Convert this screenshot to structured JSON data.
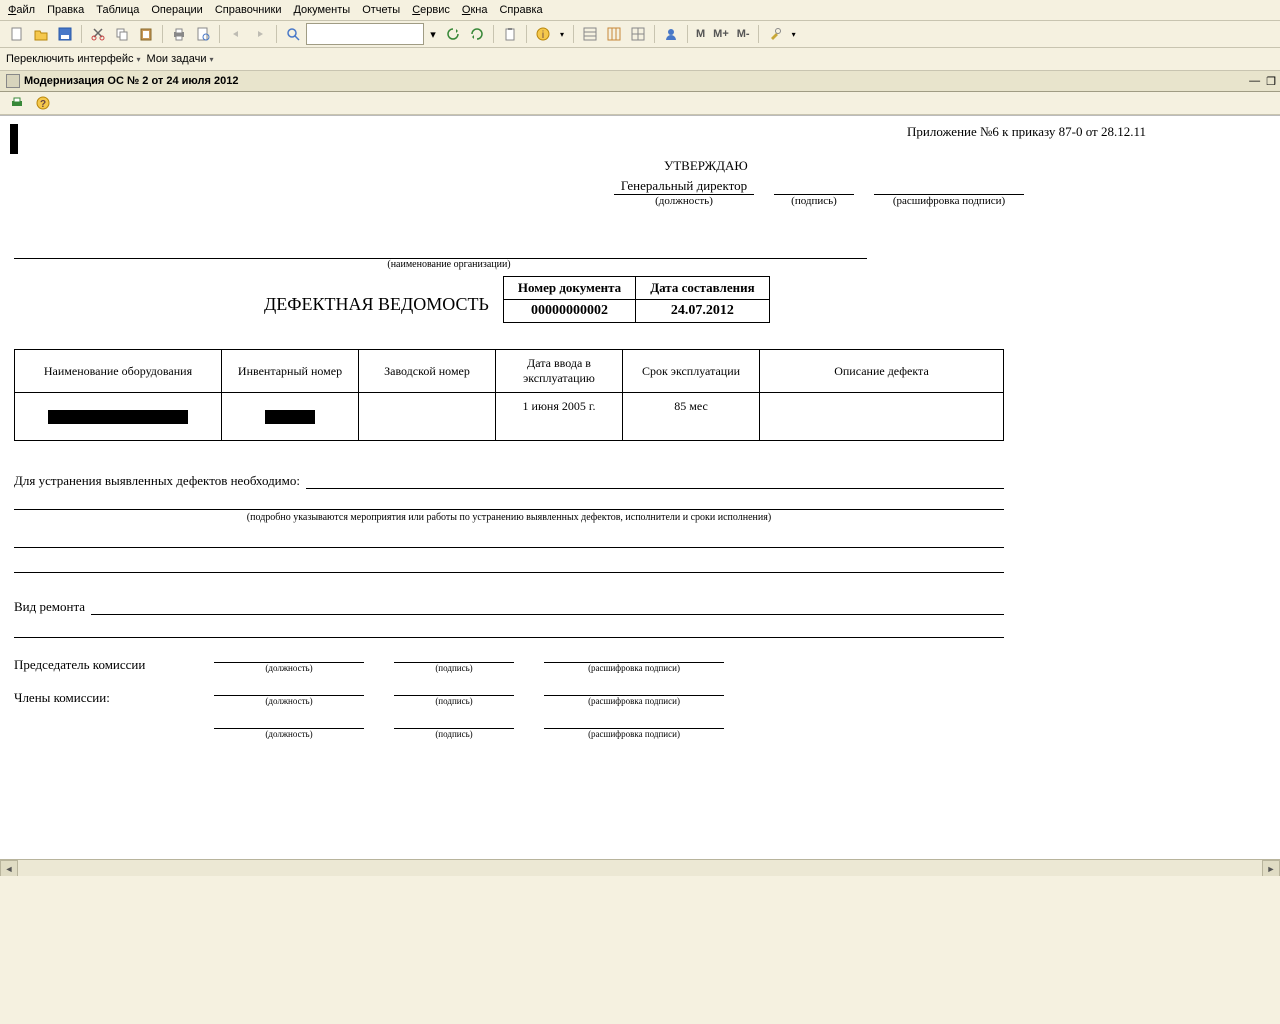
{
  "menu": {
    "file": "Файл",
    "edit": "Правка",
    "table": "Таблица",
    "operations": "Операции",
    "catalogs": "Справочники",
    "documents": "Документы",
    "reports": "Отчеты",
    "service": "Сервис",
    "windows": "Окна",
    "help": "Справка"
  },
  "toolbar": {
    "m": "M",
    "mplus": "M+",
    "mminus": "M-"
  },
  "subbar": {
    "switch_if": "Переключить интерфейс",
    "my_tasks": "Мои задачи"
  },
  "tab": {
    "title": "Модернизация ОС № 2 от 24 июля 2012"
  },
  "doc": {
    "attachment_note": "Приложение №6 к приказу 87-0 от 28.12.11",
    "approve": "УТВЕРЖДАЮ",
    "gen_director": "Генеральный директор",
    "position": "(должность)",
    "signature": "(подпись)",
    "decipher": "(расшифровка подписи)",
    "org_caption": "(наименование организации)",
    "title": "ДЕФЕКТНАЯ ВЕДОМОСТЬ",
    "num_header": "Номер документа",
    "date_header": "Дата составления",
    "num_value": "00000000002",
    "date_value": "24.07.2012",
    "equip_headers": {
      "name": "Наименование оборудования",
      "inv": "Инвентарный номер",
      "factory": "Заводской номер",
      "commission_date": "Дата ввода в эксплуатацию",
      "lifetime": "Срок эксплуатации",
      "defect": "Описание дефекта"
    },
    "equip_row": {
      "commission_date": "1 июня 2005 г.",
      "lifetime": "85 мес"
    },
    "fix_label": "Для устранения выявленных дефектов необходимо:",
    "fix_note": "(подробно указываются мероприятия или работы по устранению выявленных дефектов, исполнители и сроки исполнения)",
    "repair_type": "Вид ремонта",
    "committee_chair": "Председатель комиссии",
    "committee_members": "Члены комиссии:",
    "sig_position": "(должность)",
    "sig_sign": "(подпись)",
    "sig_decipher": "(расшифровка подписи)"
  }
}
